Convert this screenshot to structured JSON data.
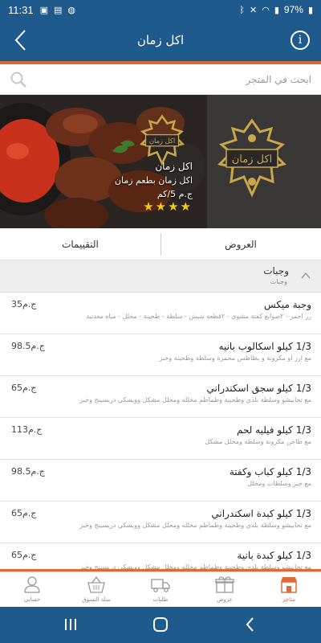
{
  "status_bar": {
    "time": "11:31",
    "battery": "97%"
  },
  "app_bar": {
    "title": "اكل زمان",
    "info_glyph": "i"
  },
  "search": {
    "placeholder": "ابحث في المتجر"
  },
  "store": {
    "name": "اكل زمان",
    "tagline": "اكل زمان بطعم زمان",
    "delivery_fee": "ج.م 5/كم",
    "rating_stars": "★★★★",
    "rating": 4
  },
  "tabs": {
    "offers": "العروض",
    "reviews": "التقييمات"
  },
  "category": {
    "name": "وجبات",
    "subtitle": "وجبات"
  },
  "items": [
    {
      "name": "وجبة ميكس",
      "desc": "رز احمر - ٢صوابع كفتة مشوى - ٢قطعة شيش - سلطة - طحينة - مخلل - مياه معدنية",
      "price": "35ج.م"
    },
    {
      "name": "1/3 كيلو اسكالوب بانيه",
      "desc": "مع ارز او مكرونة و بطاطس محمرة وسلطة وطحينة وخبز",
      "price": "98.5ج.م"
    },
    {
      "name": "1/3 كيلو سجق اسكندراني",
      "desc": "مع تحابيشو وسلطة بلدي وطحينة وطماطم مخلله ومخلل مشكل وويسكي دريسينج وخبز",
      "price": "65ج.م"
    },
    {
      "name": "1/3 كيلو فيليه لحم",
      "desc": "مع طاجن مكرونة  وسلطة ومخلل مشكل",
      "price": "113ج.م"
    },
    {
      "name": "1/3 كيلو كباب وكفتة",
      "desc": "مع خبز وسلطات ومخلل",
      "price": "98.5ج.م"
    },
    {
      "name": "1/3 كيلو كبدة اسكندراني",
      "desc": "مع تحابيشو وسلطة بلدي وطحينة وطماطم مخلله ومخلل مشكل وويسكي دريسينج وخبز",
      "price": "65ج.م"
    },
    {
      "name": "1/3 كيلو كبدة بانية",
      "desc": "مع تحابيشو وسلطة بلدي وطحينة وطماطم مخلله ومخلل مشكل وويسكي دريسينج وخبز",
      "price": "65ج.م"
    }
  ],
  "bottom_nav": {
    "stores": "متاجر",
    "offers": "عروض",
    "orders": "طلبات",
    "cart": "سلة التسوق",
    "account": "حسابي"
  },
  "colors": {
    "primary": "#1f5a8c",
    "accent": "#e06a36",
    "star": "#f5c518"
  }
}
